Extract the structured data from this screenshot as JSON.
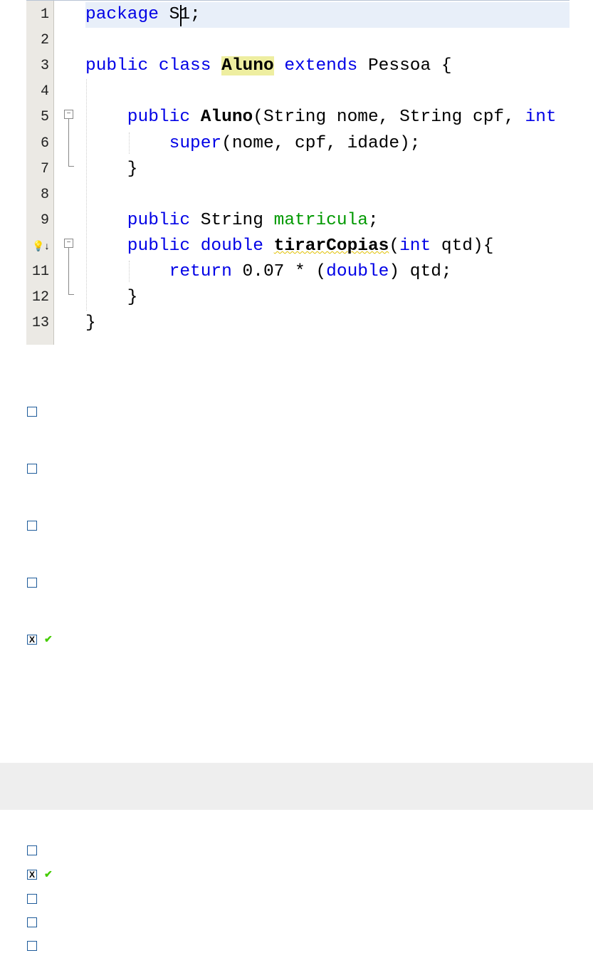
{
  "editor": {
    "line_numbers": [
      "1",
      "2",
      "3",
      "4",
      "5",
      "6",
      "7",
      "8",
      "9",
      "",
      "11",
      "12",
      "13"
    ],
    "lines": [
      [
        {
          "t": "package",
          "c": "kw"
        },
        {
          "t": " S1;"
        }
      ],
      [],
      [
        {
          "t": "public class ",
          "c": "kw"
        },
        {
          "t": "Aluno",
          "c": "b hl"
        },
        {
          "t": " extends ",
          "c": "kw"
        },
        {
          "t": "Pessoa {"
        }
      ],
      [],
      [
        {
          "t": "    public ",
          "c": "kw"
        },
        {
          "t": "Aluno",
          "c": "b"
        },
        {
          "t": "(String nome, String cpf, "
        },
        {
          "t": "int",
          "c": "kw"
        }
      ],
      [
        {
          "t": "        super",
          "c": "kw"
        },
        {
          "t": "(nome, cpf, idade);"
        }
      ],
      [
        {
          "t": "    }"
        }
      ],
      [],
      [
        {
          "t": "    public ",
          "c": "kw"
        },
        {
          "t": "String "
        },
        {
          "t": "matricula",
          "c": "fld"
        },
        {
          "t": ";"
        }
      ],
      [
        {
          "t": "    public double ",
          "c": "kw"
        },
        {
          "t": "tirarCopias",
          "c": "b warn"
        },
        {
          "t": "("
        },
        {
          "t": "int",
          "c": "kw"
        },
        {
          "t": " qtd){"
        }
      ],
      [
        {
          "t": "        return ",
          "c": "kw"
        },
        {
          "t": "0.07 * ("
        },
        {
          "t": "double",
          "c": "kw"
        },
        {
          "t": ") qtd;"
        }
      ],
      [
        {
          "t": "    }"
        }
      ],
      [
        {
          "t": "}"
        }
      ]
    ],
    "line10_icon": "lightbulb-warning-icon"
  },
  "question1": {
    "options": [
      {
        "checked": false
      },
      {
        "checked": false
      },
      {
        "checked": false
      },
      {
        "checked": false
      },
      {
        "checked": true,
        "correct": true
      }
    ]
  },
  "question2": {
    "options": [
      {
        "checked": false
      },
      {
        "checked": true,
        "correct": true
      },
      {
        "checked": false
      },
      {
        "checked": false
      },
      {
        "checked": false
      }
    ]
  },
  "marks": {
    "checked": "X",
    "correct": "✔"
  },
  "colors": {
    "keyword": "#0000e6",
    "field": "#009900",
    "checkbox_border": "#1e5b9a",
    "correct": "#44cc00"
  }
}
